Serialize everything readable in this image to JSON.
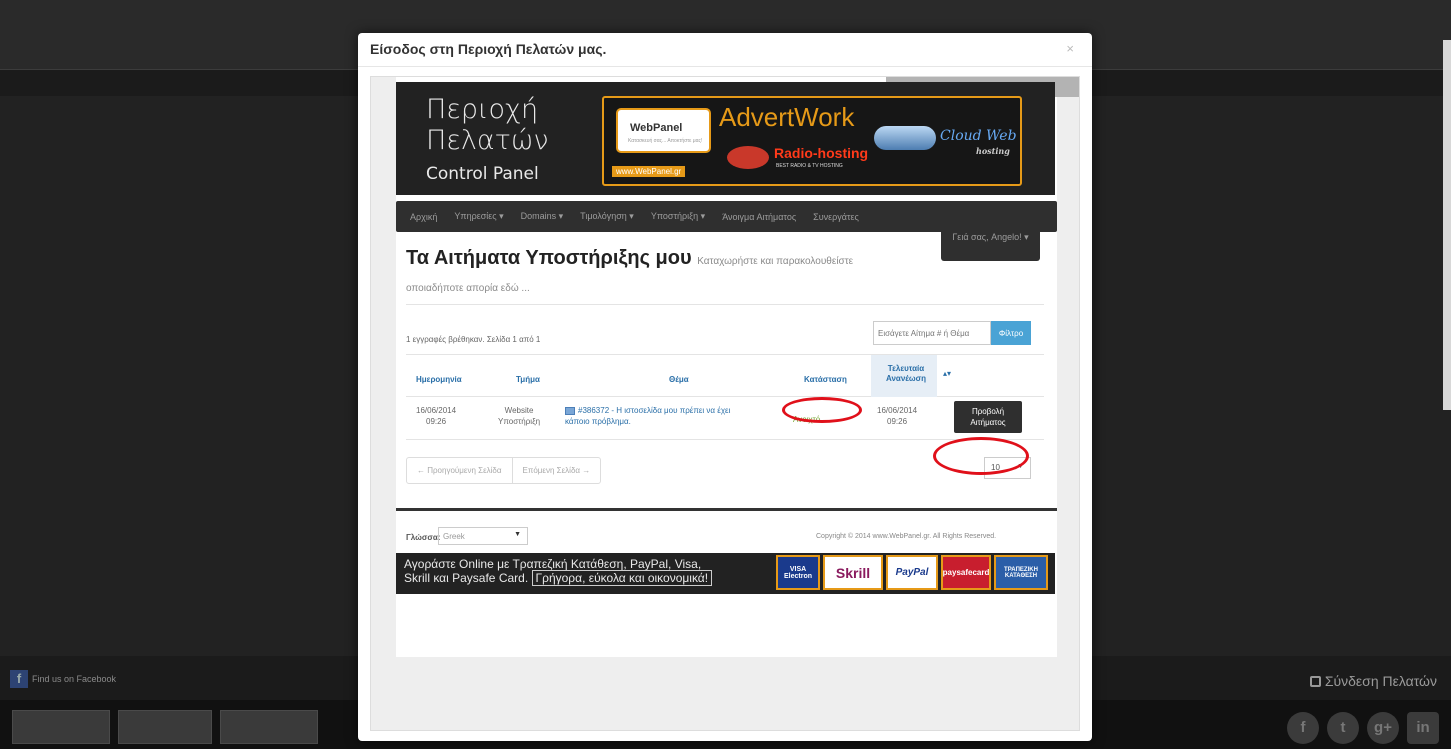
{
  "modal": {
    "title": "Είσοδος στη Περιοχή Πελατών μας.",
    "close": "×"
  },
  "banner": {
    "title_line1": "Περιοχή",
    "title_line2": "Πελατών",
    "subtitle": "Control Panel",
    "webpanel": "WebPanel",
    "webpanel_tag": "Κατασκευή σας... Αποκτήστε μας!",
    "webpanel_url": "www.WebPanel.gr",
    "advertwork": "AdvertWork",
    "radio": "Radio-hosting",
    "radio_sub": "BEST RADIO & TV HOSTING",
    "cloud": "Cloud Web",
    "cloud_sub": "hosting"
  },
  "nav": {
    "items": [
      "Αρχική",
      "Υπηρεσίες ▾",
      "Domains ▾",
      "Τιμολόγηση ▾",
      "Υποστήριξη ▾",
      "Άνοιγμα Αιτήματος",
      "Συνεργάτες"
    ],
    "user": "Γειά σας, Angelo! ▾"
  },
  "page": {
    "title": "Τα Αιτήματα Υποστήριξης μου",
    "subtitle": "Καταχωρήστε και παρακολουθείστε",
    "subtitle2": "οποιαδήποτε απορία εδώ ..."
  },
  "list": {
    "count_text": "1 εγγραφές βρέθηκαν. Σελίδα 1 από 1",
    "search_placeholder": "Εισάγετε Αίτημα # ή Θέμα",
    "filter_label": "Φίλτρο",
    "columns": [
      "Ημερομηνία",
      "Τμήμα",
      "Θέμα",
      "Κατάσταση",
      "Τελευταία Ανανέωση"
    ],
    "rows": [
      {
        "date": "16/06/2014",
        "time": "09:26",
        "dept1": "Website",
        "dept2": "Υποστήριξη",
        "subject1": "#386372 - Η ιστοσελίδα μου πρέπει να έχει",
        "subject2": "κάποιο πρόβλημα.",
        "status": "Ανοιχτό",
        "updated_date": "16/06/2014",
        "updated_time": "09:26",
        "view1": "Προβολή",
        "view2": "Αιτήματος"
      }
    ],
    "prev_page": "← Προηγούμενη Σελίδα",
    "next_page": "Επόμενη Σελίδα →",
    "per_page": "10"
  },
  "footer": {
    "lang_label": "Γλώσσα:",
    "lang_value": "Greek",
    "copyright": "Copyright © 2014 www.WebPanel.gr. All Rights Reserved."
  },
  "payments": {
    "line1": "Αγοράστε Online με Τραπεζική Κατάθεση, PayPal, Visa,",
    "line2a": "Skrill και Paysafe Card.",
    "line2b": "Γρήγορα, εύκολα και οικονομικά!",
    "logos": [
      "VISA Electron",
      "Skrill",
      "PayPal",
      "paysafecard",
      "ΤΡΑΠΕΖΙΚΗ ΚΑΤΑΘΕΣΗ"
    ]
  },
  "background": {
    "facebook": "Find us on Facebook",
    "login": "Σύνδεση Πελατών"
  },
  "colors": {
    "accent": "#e69a18",
    "link": "#2a6fa8",
    "status_open": "#72a52e",
    "annotation": "#e0101a",
    "filter_button": "#4aa3d5"
  }
}
